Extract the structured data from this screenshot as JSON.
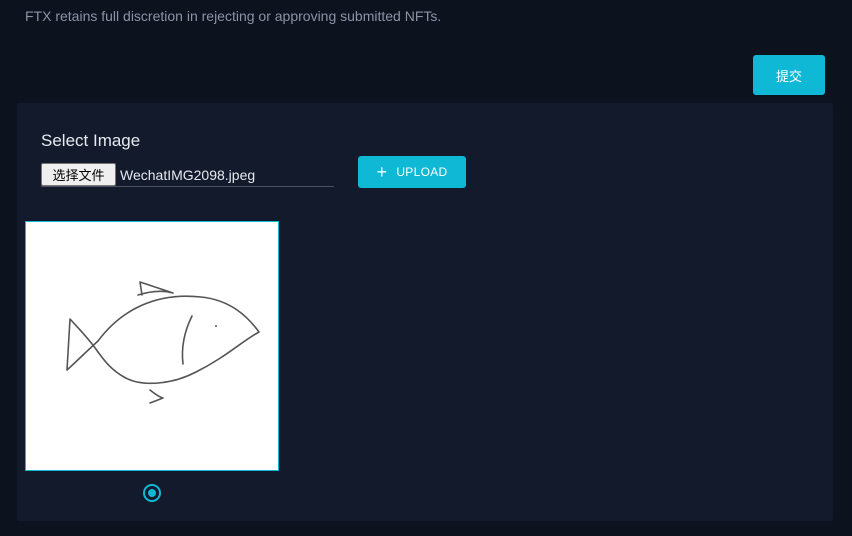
{
  "notice": {
    "text": "FTX retains full discretion in rejecting or approving submitted NFTs."
  },
  "submit": {
    "label": "提交"
  },
  "upload_panel": {
    "select_label": "Select Image",
    "file_button_label": "选择文件",
    "file_name": "WechatIMG2098.jpeg",
    "upload_button_label": "UPLOAD",
    "upload_icon": "plus-icon"
  },
  "preview": {
    "selected": true,
    "image": "fish-sketch"
  },
  "colors": {
    "background": "#0d121f",
    "panel": "#131a2b",
    "accent": "#0fb8d4"
  }
}
